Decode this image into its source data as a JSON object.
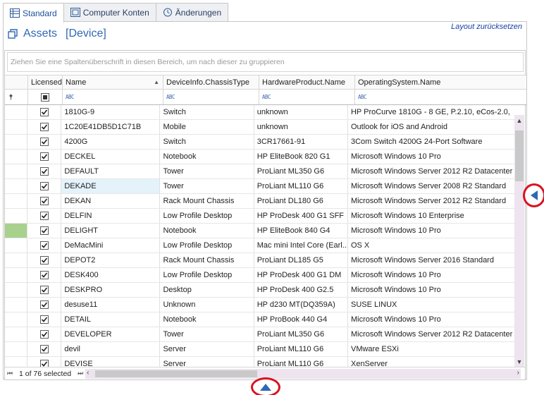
{
  "tabs": [
    {
      "label": "Standard",
      "icon": "table-icon",
      "active": true
    },
    {
      "label": "Computer Konten",
      "icon": "accounts-icon",
      "active": false
    },
    {
      "label": "Änderungen",
      "icon": "history-icon",
      "active": false
    }
  ],
  "header": {
    "title": "Assets",
    "subtitle": "[Device]",
    "reset_label": "Layout zurücksetzen"
  },
  "grid": {
    "group_panel_text": "Ziehen Sie eine Spaltenüberschrift in diesen Bereich, um nach dieser zu gruppieren",
    "columns": [
      "",
      "Licensed",
      "Name",
      "DeviceInfo.ChassisType",
      "HardwareProduct.Name",
      "OperatingSystem.Name"
    ],
    "filter_placeholder": "ABC",
    "sorted_column": "Name",
    "rows": [
      {
        "name": "1810G-9",
        "chassis": "Switch",
        "hardware": "unknown",
        "os": "HP ProCurve 1810G - 8 GE, P.2.10, eCos-2.0,",
        "licensed": true
      },
      {
        "name": "1C20E41DB5D1C71B",
        "chassis": "Mobile",
        "hardware": "unknown",
        "os": "Outlook for iOS and Android",
        "licensed": true
      },
      {
        "name": "4200G",
        "chassis": "Switch",
        "hardware": "3CR17661-91",
        "os": "3Com Switch 4200G 24-Port Software",
        "licensed": true
      },
      {
        "name": "DECKEL",
        "chassis": "Notebook",
        "hardware": "HP EliteBook 820 G1",
        "os": "Microsoft Windows 10 Pro",
        "licensed": true
      },
      {
        "name": "DEFAULT",
        "chassis": "Tower",
        "hardware": "ProLiant ML350 G6",
        "os": "Microsoft Windows Server 2012 R2 Datacenter",
        "licensed": true
      },
      {
        "name": "DEKADE",
        "chassis": "Tower",
        "hardware": "ProLiant ML110 G6",
        "os": "Microsoft Windows Server 2008 R2 Standard",
        "licensed": true,
        "focused": true
      },
      {
        "name": "DEKAN",
        "chassis": "Rack Mount Chassis",
        "hardware": "ProLiant DL180 G6",
        "os": "Microsoft Windows Server 2012 R2 Standard",
        "licensed": true
      },
      {
        "name": "DELFIN",
        "chassis": "Low Profile Desktop",
        "hardware": "HP ProDesk 400 G1 SFF",
        "os": "Microsoft Windows 10 Enterprise",
        "licensed": true
      },
      {
        "name": "DELIGHT",
        "chassis": "Notebook",
        "hardware": "HP EliteBook 840 G4",
        "os": "Microsoft Windows 10 Pro",
        "licensed": true,
        "indicator": true
      },
      {
        "name": "DeMacMini",
        "chassis": "Low Profile Desktop",
        "hardware": "Mac mini Intel Core (Earl...",
        "os": "OS X",
        "licensed": true
      },
      {
        "name": "DEPOT2",
        "chassis": "Rack Mount Chassis",
        "hardware": "ProLiant DL185 G5",
        "os": "Microsoft Windows Server 2016 Standard",
        "licensed": true
      },
      {
        "name": "DESK400",
        "chassis": "Low Profile Desktop",
        "hardware": "HP ProDesk 400 G1 DM",
        "os": "Microsoft Windows 10 Pro",
        "licensed": true
      },
      {
        "name": "DESKPRO",
        "chassis": "Desktop",
        "hardware": "HP ProDesk 400 G2.5",
        "os": "Microsoft Windows 10 Pro",
        "licensed": true
      },
      {
        "name": "desuse11",
        "chassis": "Unknown",
        "hardware": "HP d230 MT(DQ359A)",
        "os": "SUSE LINUX",
        "licensed": true
      },
      {
        "name": "DETAIL",
        "chassis": "Notebook",
        "hardware": "HP ProBook 440 G4",
        "os": "Microsoft Windows 10 Pro",
        "licensed": true
      },
      {
        "name": "DEVELOPER",
        "chassis": "Tower",
        "hardware": "ProLiant ML350 G6",
        "os": "Microsoft Windows Server 2012 R2 Datacenter",
        "licensed": true
      },
      {
        "name": "devil",
        "chassis": "Server",
        "hardware": "ProLiant ML110 G6",
        "os": "VMware ESXi",
        "licensed": true
      },
      {
        "name": "DEVISE",
        "chassis": "Server",
        "hardware": "ProLiant ML110 G6",
        "os": "XenServer",
        "licensed": true
      }
    ],
    "status_text": "1 of 76 selected"
  },
  "colors": {
    "accent": "#2f68b5",
    "highlight_ring": "#d9121f",
    "row_indicator": "#a9d18e",
    "focused_cell": "#e4f3fa"
  }
}
